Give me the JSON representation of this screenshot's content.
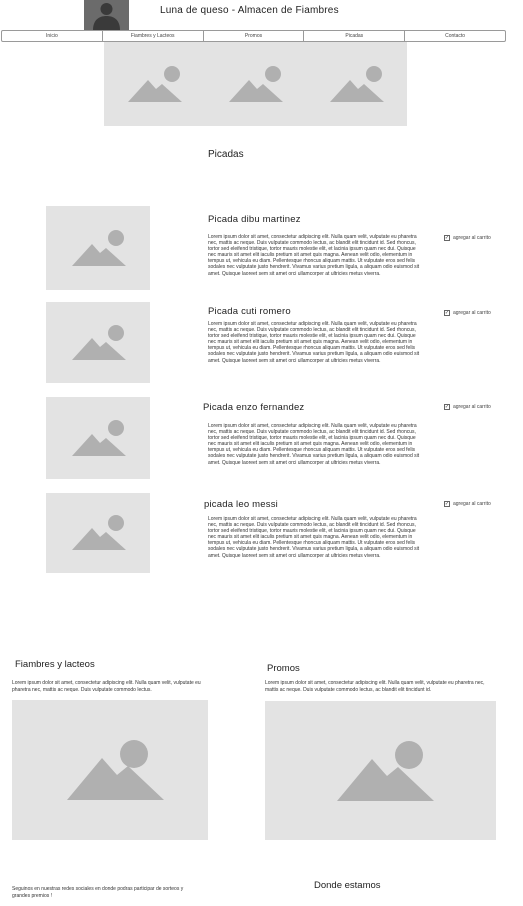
{
  "header": {
    "title": "Luna de queso - Almacen de Fiambres"
  },
  "nav": {
    "items": [
      {
        "label": "Inicio"
      },
      {
        "label": "Fiambres y Lacteos"
      },
      {
        "label": "Promos"
      },
      {
        "label": "Picadas"
      },
      {
        "label": "Contacto"
      }
    ]
  },
  "hero": {
    "images": [
      "image-placeholder",
      "image-placeholder",
      "image-placeholder"
    ]
  },
  "picadas": {
    "section_title": "Picadas",
    "products": [
      {
        "title": "Picada dibu martinez",
        "cart_label": "agregar al carrito"
      },
      {
        "title": "Picada cuti romero",
        "cart_label": "agregar al carrito"
      },
      {
        "title": "Picada enzo fernandez",
        "cart_label": "agregar al carrito"
      },
      {
        "title": "picada leo messi",
        "cart_label": "agregar al carrito"
      }
    ],
    "description": "Lorem ipsum dolor sit amet, consectetur adipiscing elit. Nulla quam velit, vulputate eu pharetra nec, mattis ac neque. Duis vulputate commodo lectus, ac blandit elit tincidunt id. Sed rhoncus, tortor sed eleifend tristique, tortor mauris molestie elit, et lacinia ipsum quam nec dui. Quisque nec mauris sit amet elit iaculis pretium sit amet quis magna. Aenean velit odio, elementum in tempus ut, vehicula eu diam. Pellentesque rhoncus aliquam mattis. Ut vulputate eros sed felis sodales nec vulputate justo hendrerit. Vivamus varius pretium ligula, a aliquam odio euismod sit amet. Quisque laoreet sem sit amet orci ullamcorper at ultricies metus viverra."
  },
  "fiambres": {
    "title": "Fiambres y lacteos",
    "text": "Lorem ipsum dolor sit amet, consectetur adipiscing elit. Nulla quam velit, vulputate eu pharetra nec, mattis ac neque. Duis vulputate commodo lectus."
  },
  "promos": {
    "title": "Promos",
    "text": "Lorem ipsum dolor sit amet, consectetur adipiscing elit. Nulla quam velit, vulputate eu pharetra nec, mattis ac neque. Duis vulputate commodo lectus, ac blandit elit tincidunt id."
  },
  "footer": {
    "social_text": "Seguinos en nuestras redes sociales en donde podras participar de sorteos y grandes premios !",
    "location_title": "Donde estamos"
  },
  "colors": {
    "placeholder_bg": "#e3e3e3",
    "placeholder_icon": "#b0b0b0",
    "avatar_bg": "#6b6b6b"
  }
}
